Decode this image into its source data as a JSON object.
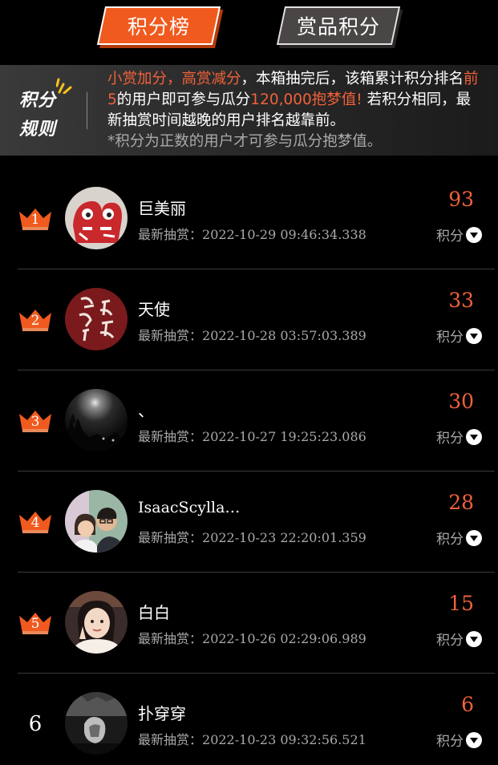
{
  "tabs": [
    {
      "label": "积分榜",
      "active": true
    },
    {
      "label": "赏品积分",
      "active": false
    }
  ],
  "rules": {
    "badge_line1": "积分",
    "badge_line2": "规则",
    "seg1_hl": "小赏加分，高赏减分",
    "seg2": "，本箱抽完后，该箱累计积分排名",
    "seg3_hl": "前5",
    "seg4": "的用户即可参与瓜分",
    "seg5_hl": "120,000抱梦值!",
    "seg6": " 若积分相同，最新抽赏时间越晚的用户排名越靠前。",
    "note": "*积分为正数的用户才可参与瓜分抱梦值。"
  },
  "list_labels": {
    "draw_time_label": "最新抽赏：",
    "score_label": "积分"
  },
  "entries": [
    {
      "rank": "1",
      "name": "巨美丽",
      "time": "2022-10-29 09:46:34.338",
      "score": "93",
      "avatar": "red-doodle-avatar"
    },
    {
      "rank": "2",
      "name": "天使",
      "time": "2022-10-28 03:57:03.389",
      "score": "33",
      "avatar": "calligraphy-avatar"
    },
    {
      "rank": "3",
      "name": "、",
      "time": "2022-10-27 19:25:23.086",
      "score": "30",
      "avatar": "moon-night-avatar"
    },
    {
      "rank": "4",
      "name": "IsaacScylla…",
      "time": "2022-10-23 22:20:01.359",
      "score": "28",
      "avatar": "couple-photo-avatar"
    },
    {
      "rank": "5",
      "name": "白白",
      "time": "2022-10-26 02:29:06.989",
      "score": "15",
      "avatar": "girl-photo-avatar"
    },
    {
      "rank": "6",
      "name": "扑穿穿",
      "time": "2022-10-23 09:32:56.521",
      "score": "6",
      "avatar": "bw-photo-avatar"
    }
  ],
  "colors": {
    "accent": "#f05a1e",
    "score": "#f0613a",
    "muted_text": "#a9a9a9",
    "background": "#000000"
  }
}
